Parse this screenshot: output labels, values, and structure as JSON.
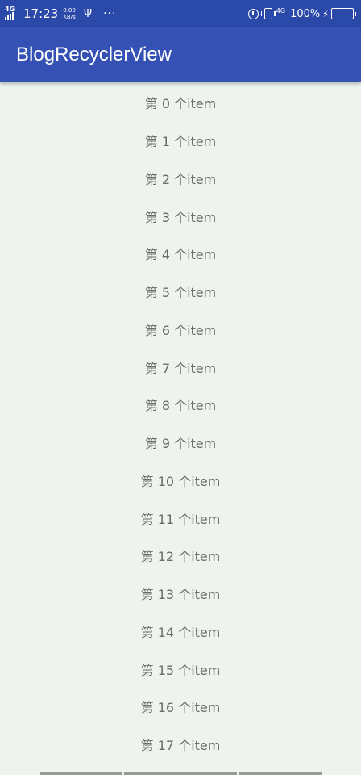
{
  "status_bar": {
    "signal_type": "4G",
    "time": "17:23",
    "net_speed_value": "0.00",
    "net_speed_unit": "KB/s",
    "usb_icon": "usb-icon",
    "more": "···",
    "network_type": "4G",
    "battery": "100%",
    "charging_icon": "⚡"
  },
  "app_bar": {
    "title": "BlogRecyclerView"
  },
  "list": {
    "items": [
      "第 0 个item",
      "第 1 个item",
      "第 2 个item",
      "第 3 个item",
      "第 4 个item",
      "第 5 个item",
      "第 6 个item",
      "第 7 个item",
      "第 8 个item",
      "第 9 个item",
      "第 10 个item",
      "第 11 个item",
      "第 12 个item",
      "第 13 个item",
      "第 14 个item",
      "第 15 个item",
      "第 16 个item",
      "第 17 个item"
    ]
  },
  "colors": {
    "status_bar": "#2a49a8",
    "app_bar": "#3451b3",
    "background": "#eef3ee",
    "item_text": "#6c6c6c"
  }
}
